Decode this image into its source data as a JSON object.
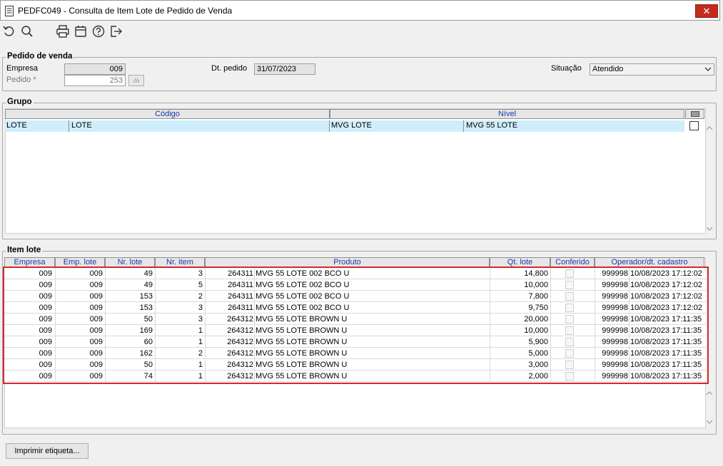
{
  "window": {
    "title": "PEDFC049 - Consulta de Item Lote de Pedido de Venda",
    "close_label": "✕"
  },
  "toolbar": {
    "icons": [
      "undo-icon",
      "search-icon",
      "print-icon",
      "calendar-icon",
      "help-icon",
      "exit-icon"
    ]
  },
  "pedido": {
    "group_label": "Pedido de venda",
    "empresa_label": "Empresa",
    "empresa_value": "009",
    "pedido_label": "Pedido *",
    "pedido_value": "253",
    "dt_label": "Dt. pedido",
    "dt_value": "31/07/2023",
    "situacao_label": "Situação",
    "situacao_value": "Atendido"
  },
  "grupo": {
    "group_label": "Grupo",
    "headers": [
      "Código",
      "Nível"
    ],
    "row": [
      "LOTE",
      "LOTE",
      "MVG LOTE",
      "MVG 55 LOTE"
    ]
  },
  "item_lote": {
    "group_label": "Item lote",
    "headers": [
      "Empresa",
      "Emp. lote",
      "Nr. lote",
      "Nr. item",
      "Produto",
      "Qt. lote",
      "Conferido",
      "Operador/dt. cadastro"
    ],
    "rows": [
      {
        "empresa": "009",
        "emp_lote": "009",
        "nr_lote": "49",
        "nr_item": "3",
        "prod_code": "264311",
        "prod_desc": "MVG 55 LOTE 002 BCO U",
        "qt": "14,800",
        "operador": "999998",
        "dt": "10/08/2023 17:12:02"
      },
      {
        "empresa": "009",
        "emp_lote": "009",
        "nr_lote": "49",
        "nr_item": "5",
        "prod_code": "264311",
        "prod_desc": "MVG 55 LOTE 002 BCO U",
        "qt": "10,000",
        "operador": "999998",
        "dt": "10/08/2023 17:12:02"
      },
      {
        "empresa": "009",
        "emp_lote": "009",
        "nr_lote": "153",
        "nr_item": "2",
        "prod_code": "264311",
        "prod_desc": "MVG 55 LOTE 002 BCO U",
        "qt": "7,800",
        "operador": "999998",
        "dt": "10/08/2023 17:12:02"
      },
      {
        "empresa": "009",
        "emp_lote": "009",
        "nr_lote": "153",
        "nr_item": "3",
        "prod_code": "264311",
        "prod_desc": "MVG 55 LOTE 002 BCO U",
        "qt": "9,750",
        "operador": "999998",
        "dt": "10/08/2023 17:12:02"
      },
      {
        "empresa": "009",
        "emp_lote": "009",
        "nr_lote": "50",
        "nr_item": "3",
        "prod_code": "264312",
        "prod_desc": "MVG 55 LOTE BROWN U",
        "qt": "20,000",
        "operador": "999998",
        "dt": "10/08/2023 17:11:35"
      },
      {
        "empresa": "009",
        "emp_lote": "009",
        "nr_lote": "169",
        "nr_item": "1",
        "prod_code": "264312",
        "prod_desc": "MVG 55 LOTE BROWN U",
        "qt": "10,000",
        "operador": "999998",
        "dt": "10/08/2023 17:11:35"
      },
      {
        "empresa": "009",
        "emp_lote": "009",
        "nr_lote": "60",
        "nr_item": "1",
        "prod_code": "264312",
        "prod_desc": "MVG 55 LOTE BROWN U",
        "qt": "5,900",
        "operador": "999998",
        "dt": "10/08/2023 17:11:35"
      },
      {
        "empresa": "009",
        "emp_lote": "009",
        "nr_lote": "162",
        "nr_item": "2",
        "prod_code": "264312",
        "prod_desc": "MVG 55 LOTE BROWN U",
        "qt": "5,000",
        "operador": "999998",
        "dt": "10/08/2023 17:11:35"
      },
      {
        "empresa": "009",
        "emp_lote": "009",
        "nr_lote": "50",
        "nr_item": "1",
        "prod_code": "264312",
        "prod_desc": "MVG 55 LOTE BROWN U",
        "qt": "3,000",
        "operador": "999998",
        "dt": "10/08/2023 17:11:35"
      },
      {
        "empresa": "009",
        "emp_lote": "009",
        "nr_lote": "74",
        "nr_item": "1",
        "prod_code": "264312",
        "prod_desc": "MVG 55 LOTE BROWN U",
        "qt": "2,000",
        "operador": "999998",
        "dt": "10/08/2023 17:11:35"
      }
    ]
  },
  "footer": {
    "print_label": "Imprimir etiqueta..."
  },
  "colors": {
    "header_text": "#1a3aa8",
    "selected_row": "#cfeefc",
    "highlight": "#d9262f",
    "close_button": "#c42b1c"
  }
}
